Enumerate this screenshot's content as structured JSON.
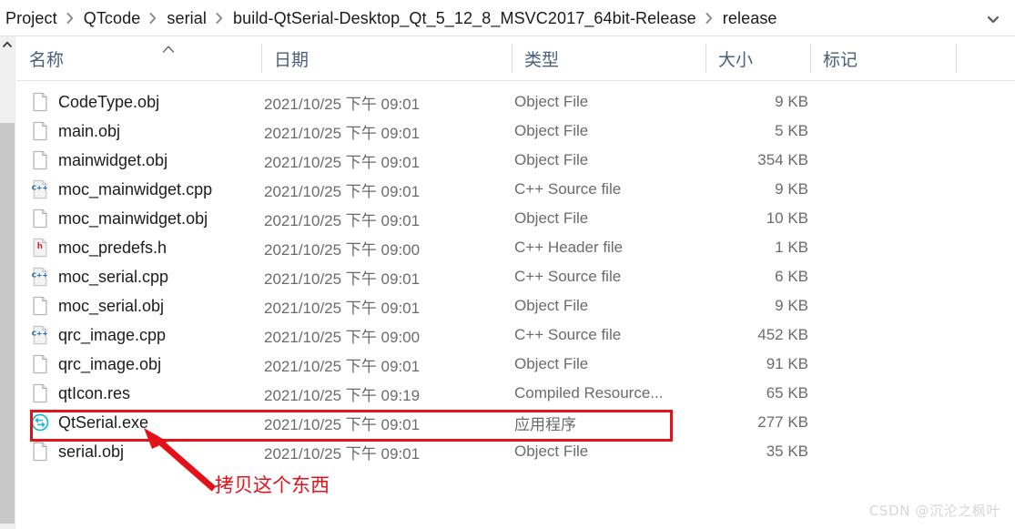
{
  "window": {
    "title": "release",
    "chevron_icon": "chevron-down-icon"
  },
  "breadcrumb": {
    "separator_icon": "chevron-right-icon",
    "items": [
      {
        "label": "Project"
      },
      {
        "label": "QTcode"
      },
      {
        "label": "serial"
      },
      {
        "label": "build-QtSerial-Desktop_Qt_5_12_8_MSVC2017_64bit-Release"
      },
      {
        "label": "release"
      }
    ]
  },
  "columns": [
    {
      "key": "name",
      "label": "名称",
      "sorted": "ascending",
      "sort_icon": "caret-up-icon"
    },
    {
      "key": "date",
      "label": "日期"
    },
    {
      "key": "type",
      "label": "类型"
    },
    {
      "key": "size",
      "label": "大小"
    },
    {
      "key": "tags",
      "label": "标记"
    }
  ],
  "files": [
    {
      "name": "CodeType.obj",
      "icon": "generic-file-icon",
      "date": "2021/10/25 下午 09:01",
      "type": "Object File",
      "size": "9 KB",
      "highlighted": false
    },
    {
      "name": "main.obj",
      "icon": "generic-file-icon",
      "date": "2021/10/25 下午 09:01",
      "type": "Object File",
      "size": "5 KB",
      "highlighted": false
    },
    {
      "name": "mainwidget.obj",
      "icon": "generic-file-icon",
      "date": "2021/10/25 下午 09:01",
      "type": "Object File",
      "size": "354 KB",
      "highlighted": false
    },
    {
      "name": "moc_mainwidget.cpp",
      "icon": "cpp-file-icon",
      "date": "2021/10/25 下午 09:01",
      "type": "C++ Source file",
      "size": "9 KB",
      "highlighted": false
    },
    {
      "name": "moc_mainwidget.obj",
      "icon": "generic-file-icon",
      "date": "2021/10/25 下午 09:01",
      "type": "Object File",
      "size": "10 KB",
      "highlighted": false
    },
    {
      "name": "moc_predefs.h",
      "icon": "header-file-icon",
      "date": "2021/10/25 下午 09:00",
      "type": "C++ Header file",
      "size": "1 KB",
      "highlighted": false
    },
    {
      "name": "moc_serial.cpp",
      "icon": "cpp-file-icon",
      "date": "2021/10/25 下午 09:01",
      "type": "C++ Source file",
      "size": "6 KB",
      "highlighted": false
    },
    {
      "name": "moc_serial.obj",
      "icon": "generic-file-icon",
      "date": "2021/10/25 下午 09:01",
      "type": "Object File",
      "size": "9 KB",
      "highlighted": false
    },
    {
      "name": "qrc_image.cpp",
      "icon": "cpp-file-icon",
      "date": "2021/10/25 下午 09:00",
      "type": "C++ Source file",
      "size": "452 KB",
      "highlighted": false
    },
    {
      "name": "qrc_image.obj",
      "icon": "generic-file-icon",
      "date": "2021/10/25 下午 09:01",
      "type": "Object File",
      "size": "91 KB",
      "highlighted": false
    },
    {
      "name": "qtIcon.res",
      "icon": "generic-file-icon",
      "date": "2021/10/25 下午 09:19",
      "type": "Compiled Resource...",
      "size": "65 KB",
      "highlighted": false
    },
    {
      "name": "QtSerial.exe",
      "icon": "qt-serial-app-icon",
      "date": "2021/10/25 下午 09:01",
      "type": "应用程序",
      "size": "277 KB",
      "highlighted": true
    },
    {
      "name": "serial.obj",
      "icon": "generic-file-icon",
      "date": "2021/10/25 下午 09:01",
      "type": "Object File",
      "size": "35 KB",
      "highlighted": false
    }
  ],
  "annotation": {
    "text": "拷贝这个东西",
    "color": "#e3121a",
    "arrow_icon": "arrow-pointer-icon",
    "highlight_box_target": "QtSerial.exe"
  },
  "watermark": {
    "text": "CSDN @沉沦之枫叶"
  },
  "scrollbar": {
    "up_arrow_icon": "caret-up-icon",
    "thumb": "scroll-thumb"
  }
}
